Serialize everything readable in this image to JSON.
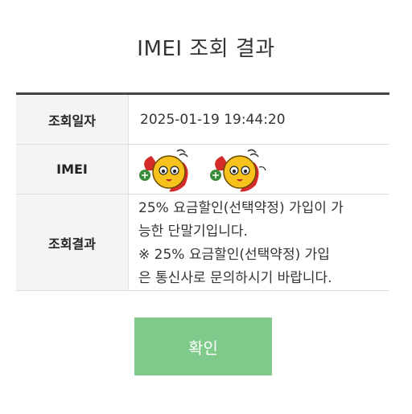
{
  "page": {
    "title": "IMEI 조회 결과"
  },
  "table": {
    "rows": [
      {
        "header": "조회일자",
        "value": "2025-01-19 19:44:20"
      },
      {
        "header": "IMEI",
        "value_icon": "cartoon-sticker-icon"
      },
      {
        "header": "조회결과",
        "lines": [
          "25% 요금할인(선택약정) 가입이 가",
          "능한 단말기입니다.",
          "※ 25% 요금할인(선택약정) 가입",
          "은 통신사로 문의하시기 바랍니다."
        ]
      }
    ]
  },
  "button": {
    "confirm_label": "확인"
  },
  "colors": {
    "button": "#7fc98a",
    "table_border": "#444444",
    "header_bg": "#f4f4f4"
  }
}
